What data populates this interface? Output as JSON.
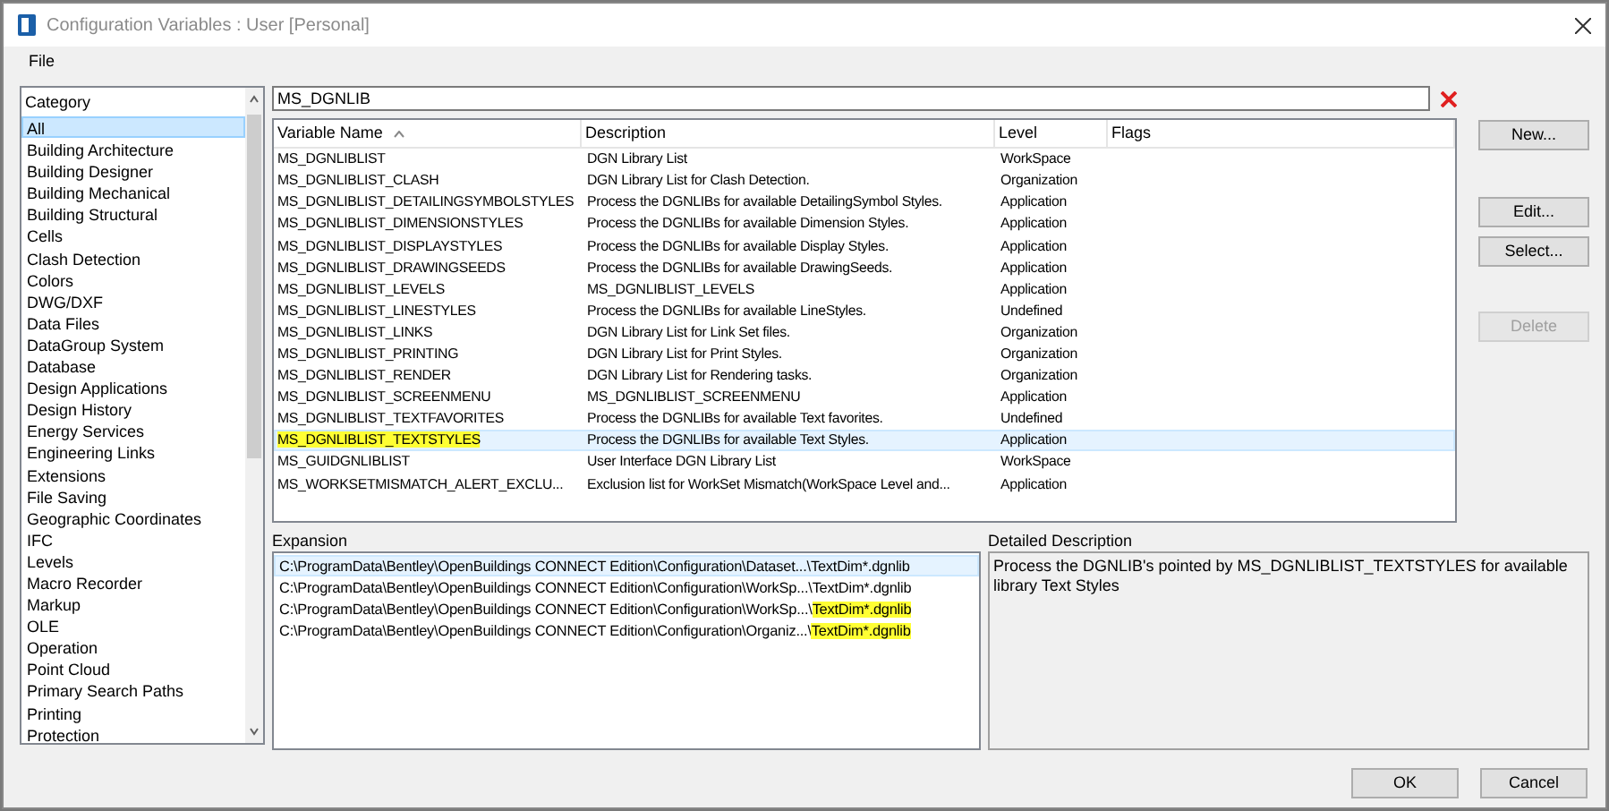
{
  "window": {
    "title": "Configuration Variables : User [Personal]"
  },
  "menu": [
    "File"
  ],
  "category": {
    "header": "Category",
    "items": [
      {
        "label": "All",
        "selected": true
      },
      {
        "label": "Building Architecture",
        "selected": false
      },
      {
        "label": "Building Designer",
        "selected": false
      },
      {
        "label": "Building Mechanical",
        "selected": false
      },
      {
        "label": "Building Structural",
        "selected": false
      },
      {
        "label": "Cells",
        "selected": false
      },
      {
        "label": "Clash Detection",
        "selected": false
      },
      {
        "label": "Colors",
        "selected": false
      },
      {
        "label": "DWG/DXF",
        "selected": false
      },
      {
        "label": "Data Files",
        "selected": false
      },
      {
        "label": "DataGroup System",
        "selected": false
      },
      {
        "label": "Database",
        "selected": false
      },
      {
        "label": "Design Applications",
        "selected": false
      },
      {
        "label": "Design History",
        "selected": false
      },
      {
        "label": "Energy Services",
        "selected": false
      },
      {
        "label": "Engineering Links",
        "selected": false
      },
      {
        "label": "Extensions",
        "selected": false
      },
      {
        "label": "File Saving",
        "selected": false
      },
      {
        "label": "Geographic Coordinates",
        "selected": false
      },
      {
        "label": "IFC",
        "selected": false
      },
      {
        "label": "Levels",
        "selected": false
      },
      {
        "label": "Macro Recorder",
        "selected": false
      },
      {
        "label": "Markup",
        "selected": false
      },
      {
        "label": "OLE",
        "selected": false
      },
      {
        "label": "Operation",
        "selected": false
      },
      {
        "label": "Point Cloud",
        "selected": false
      },
      {
        "label": "Primary Search Paths",
        "selected": false
      },
      {
        "label": "Printing",
        "selected": false
      },
      {
        "label": "Protection",
        "selected": false
      }
    ]
  },
  "search": {
    "value": "MS_DGNLIB"
  },
  "table": {
    "columns": [
      "Variable Name",
      "Description",
      "Level",
      "Flags"
    ],
    "rows": [
      {
        "name": "MS_DGNLIBLIST",
        "description": "DGN Library List",
        "level": "WorkSpace",
        "selected": false,
        "highlighted": false
      },
      {
        "name": "MS_DGNLIBLIST_CLASH",
        "description": "DGN Library List for Clash Detection.",
        "level": "Organization",
        "selected": false,
        "highlighted": false
      },
      {
        "name": "MS_DGNLIBLIST_DETAILINGSYMBOLSTYLES",
        "description": "Process the DGNLIBs for available DetailingSymbol Styles.",
        "level": "Application",
        "selected": false,
        "highlighted": false
      },
      {
        "name": "MS_DGNLIBLIST_DIMENSIONSTYLES",
        "description": "Process the DGNLIBs for available Dimension Styles.",
        "level": "Application",
        "selected": false,
        "highlighted": false
      },
      {
        "name": "MS_DGNLIBLIST_DISPLAYSTYLES",
        "description": "Process the DGNLIBs for available Display Styles.",
        "level": "Application",
        "selected": false,
        "highlighted": false
      },
      {
        "name": "MS_DGNLIBLIST_DRAWINGSEEDS",
        "description": "Process the DGNLIBs for available DrawingSeeds.",
        "level": "Application",
        "selected": false,
        "highlighted": false
      },
      {
        "name": "MS_DGNLIBLIST_LEVELS",
        "description": "MS_DGNLIBLIST_LEVELS",
        "level": "Application",
        "selected": false,
        "highlighted": false
      },
      {
        "name": "MS_DGNLIBLIST_LINESTYLES",
        "description": "Process the DGNLIBs for available LineStyles.",
        "level": "Undefined",
        "selected": false,
        "highlighted": false
      },
      {
        "name": "MS_DGNLIBLIST_LINKS",
        "description": "DGN Library List for Link Set files.",
        "level": "Organization",
        "selected": false,
        "highlighted": false
      },
      {
        "name": "MS_DGNLIBLIST_PRINTING",
        "description": "DGN Library List for Print Styles.",
        "level": "Organization",
        "selected": false,
        "highlighted": false
      },
      {
        "name": "MS_DGNLIBLIST_RENDER",
        "description": "DGN Library List for Rendering tasks.",
        "level": "Organization",
        "selected": false,
        "highlighted": false
      },
      {
        "name": "MS_DGNLIBLIST_SCREENMENU",
        "description": "MS_DGNLIBLIST_SCREENMENU",
        "level": "Application",
        "selected": false,
        "highlighted": false
      },
      {
        "name": "MS_DGNLIBLIST_TEXTFAVORITES",
        "description": "Process the DGNLIBs for available Text favorites.",
        "level": "Undefined",
        "selected": false,
        "highlighted": false
      },
      {
        "name": "MS_DGNLIBLIST_TEXTSTYLES",
        "description": "Process the DGNLIBs for available Text Styles.",
        "level": "Application",
        "selected": true,
        "highlighted": true
      },
      {
        "name": "MS_GUIDGNLIBLIST",
        "description": "User Interface DGN Library List",
        "level": "WorkSpace",
        "selected": false,
        "highlighted": false
      },
      {
        "name": "MS_WORKSETMISMATCH_ALERT_EXCLU...",
        "description": "Exclusion list for WorkSet Mismatch(WorkSpace Level and...",
        "level": "Application",
        "selected": false,
        "highlighted": false
      }
    ]
  },
  "buttons": [
    {
      "label": "New...",
      "disabled": false
    },
    {
      "label": "Edit...",
      "disabled": false
    },
    {
      "label": "Select...",
      "disabled": false
    },
    {
      "label": "Delete",
      "disabled": true
    }
  ],
  "expansion": {
    "label": "Expansion",
    "lines": [
      {
        "path": "C:\\ProgramData\\Bentley\\OpenBuildings CONNECT Edition\\Configuration\\Dataset...\\",
        "file": "TextDim*.dgnlib",
        "selected": true,
        "highlighted": false
      },
      {
        "path": "C:\\ProgramData\\Bentley\\OpenBuildings CONNECT Edition\\Configuration\\WorkSp...\\",
        "file": "TextDim*.dgnlib",
        "selected": false,
        "highlighted": false
      },
      {
        "path": "C:\\ProgramData\\Bentley\\OpenBuildings CONNECT Edition\\Configuration\\WorkSp...\\",
        "file": "TextDim*.dgnlib",
        "selected": false,
        "highlighted": true
      },
      {
        "path": "C:\\ProgramData\\Bentley\\OpenBuildings CONNECT Edition\\Configuration\\Organiz...\\",
        "file": "TextDim*.dgnlib",
        "selected": false,
        "highlighted": true
      }
    ]
  },
  "details": {
    "label": "Detailed Description",
    "text": "Process the DGNLIB's pointed by MS_DGNLIBLIST_TEXTSTYLES for available library Text Styles"
  },
  "footer_buttons": [
    "OK",
    "Cancel"
  ]
}
